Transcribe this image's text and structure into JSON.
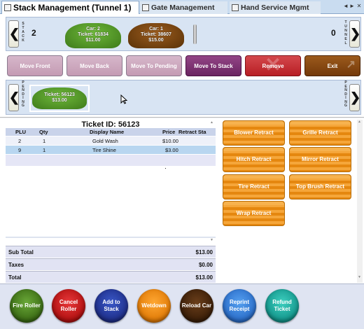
{
  "tabs": [
    {
      "label": "Stack Management (Tunnel 1)"
    },
    {
      "label": "Gate Management"
    },
    {
      "label": "Hand Service Mgmt"
    }
  ],
  "window_controls": {
    "prev": "◄",
    "next": "►",
    "close": "✕"
  },
  "stack": {
    "side_label": "STACK",
    "count": "2",
    "tunnel_label": "TUNNEL",
    "tunnel_count": "0",
    "left_arrow": "❮",
    "right_arrow": "❯",
    "cars": [
      {
        "car": "Car: 2",
        "ticket": "Ticket: 61834",
        "amount": "$11.00",
        "color": "green"
      },
      {
        "car": "Car: 1",
        "ticket": "Ticket: 38607",
        "amount": "$15.00",
        "color": "brown"
      }
    ]
  },
  "actions": [
    {
      "label": "Move Front"
    },
    {
      "label": "Move Back"
    },
    {
      "label": "Move To Pending"
    },
    {
      "label": "Move To Stack"
    },
    {
      "label": "Remove"
    },
    {
      "label": "Exit"
    }
  ],
  "pending": {
    "label": "PENDING",
    "left_arrow": "❮",
    "right_arrow": "❯",
    "car": {
      "ticket": "Ticket: 56123",
      "amount": "$13.00",
      "color": "green"
    }
  },
  "ticket": {
    "title": "Ticket ID: 56123",
    "columns": [
      "PLU",
      "Qty",
      "Display Name",
      "Price",
      "Retract Sta"
    ],
    "rows": [
      {
        "plu": "2",
        "qty": "1",
        "name": "Gold Wash",
        "price": "$10.00",
        "retract": ""
      },
      {
        "plu": "9",
        "qty": "1",
        "name": "Tire Shine",
        "price": "$3.00",
        "retract": ""
      }
    ],
    "totals": [
      {
        "label": "Sub Total",
        "value": "$13.00"
      },
      {
        "label": "Taxes",
        "value": "$0.00"
      },
      {
        "label": "Total",
        "value": "$13.00"
      }
    ]
  },
  "retracts": [
    {
      "label": "Blower Retract"
    },
    {
      "label": "Grille Retract"
    },
    {
      "label": "Hitch Retract"
    },
    {
      "label": "Mirror Retract"
    },
    {
      "label": "Tire Retract"
    },
    {
      "label": "Top Brush Retract"
    },
    {
      "label": "Wrap Retract"
    }
  ],
  "bottom_buttons": [
    {
      "label": "Fire Roller",
      "color": "#4a7a1c"
    },
    {
      "label": "Cancel Roller",
      "color": "#c81818"
    },
    {
      "label": "Add to Stack",
      "color": "#2a3fa0"
    },
    {
      "label": "Wetdown",
      "color": "#f08c10"
    },
    {
      "label": "Reload Car",
      "color": "#4a2a10"
    },
    {
      "label": "Reprint Receipt",
      "color": "#2f7ad8"
    },
    {
      "label": "Refund Ticket",
      "color": "#1aaa9a"
    }
  ],
  "colors": {
    "action_button": "#c9a0b8",
    "action_active": "#7b2f6b",
    "remove": "#c1272d",
    "exit": "#8a4a10",
    "retract": "#e5870f"
  }
}
